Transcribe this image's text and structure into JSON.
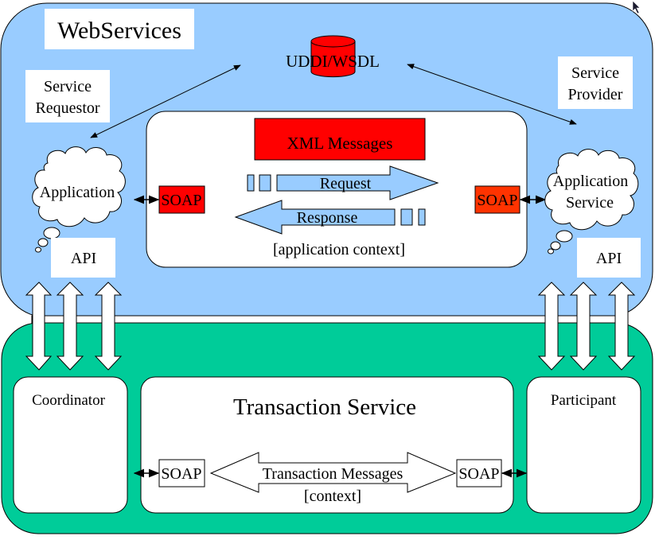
{
  "colors": {
    "webservices_bg": "#99ccff",
    "transaction_bg": "#00cc99",
    "soap_red": "#ff0000",
    "soap_orange_red": "#ff3300",
    "xml_red": "#ff0000",
    "uddi_red": "#ff0000",
    "message_arrow_fill": "#99ccff",
    "box_white": "#ffffff",
    "stroke": "#000000"
  },
  "webservices": {
    "title": "WebServices",
    "registry": {
      "label": "UDDI/WSDL",
      "icon": "database-cylinder-icon"
    },
    "requestor": {
      "role_line1": "Service",
      "role_line2": "Requestor",
      "cloud_label": "Application",
      "api_label": "API",
      "soap_label": "SOAP"
    },
    "provider": {
      "role_line1": "Service",
      "role_line2": "Provider",
      "cloud_line1": "Application",
      "cloud_line2": "Service",
      "api_label": "API",
      "soap_label": "SOAP"
    },
    "messages": {
      "header": "XML Messages",
      "request_label": "Request",
      "response_label": "Response",
      "context_label": "[application context]"
    }
  },
  "transaction": {
    "title": "Transaction Service",
    "coordinator_label": "Coordinator",
    "participant_label": "Participant",
    "left_soap_label": "SOAP",
    "right_soap_label": "SOAP",
    "messages_label": "Transaction Messages",
    "context_label": "[context]"
  }
}
